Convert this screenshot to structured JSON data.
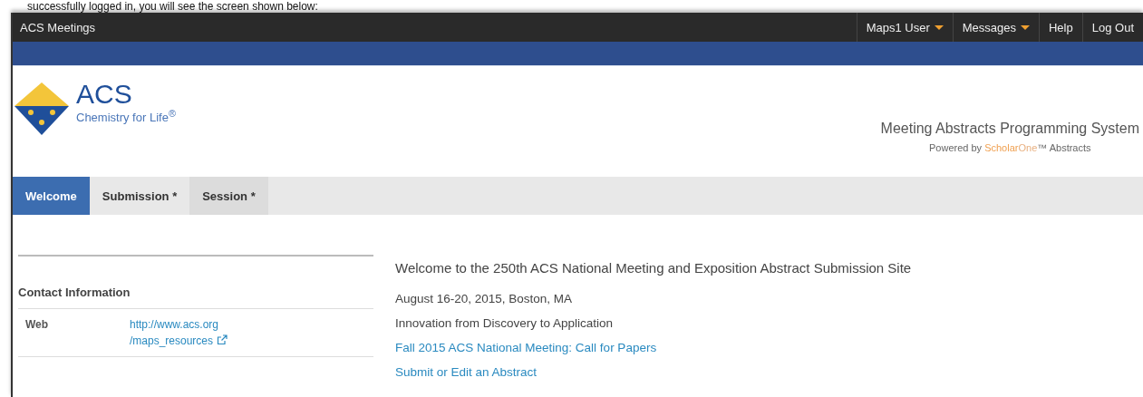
{
  "caption": "successfully logged in, you will see the screen shown below:",
  "top_bar": {
    "title": "ACS Meetings",
    "menu": [
      {
        "label": "Maps1 User",
        "dropdown": true
      },
      {
        "label": "Messages",
        "dropdown": true
      },
      {
        "label": "Help",
        "dropdown": false
      },
      {
        "label": "Log Out",
        "dropdown": false
      }
    ]
  },
  "header": {
    "logo_name": "ACS",
    "logo_tagline": "Chemistry for Life",
    "logo_tagline_mark": "®",
    "system_title": "Meeting Abstracts Programming System",
    "powered": {
      "prefix": "Powered by ",
      "brand_a": "Scholar",
      "brand_b": "One",
      "suffix": "™ Abstracts"
    }
  },
  "tabs": [
    {
      "label": "Welcome",
      "selected": true
    },
    {
      "label": "Submission *",
      "selected": false
    },
    {
      "label": "Session *",
      "selected": false
    }
  ],
  "contact": {
    "heading": "Contact Information",
    "rows": [
      {
        "label": "Web",
        "lines": [
          "http://www.acs.org",
          "/maps_resources"
        ]
      }
    ]
  },
  "main": [
    {
      "kind": "heading",
      "text": "Welcome to the 250th ACS National Meeting and Exposition Abstract Submission Site"
    },
    {
      "kind": "text",
      "text": "August 16-20, 2015, Boston, MA"
    },
    {
      "kind": "text",
      "text": "Innovation from Discovery to Application"
    },
    {
      "kind": "link",
      "text": "Fall 2015 ACS National Meeting: Call for Papers"
    },
    {
      "kind": "link",
      "text": "Submit or Edit an Abstract"
    }
  ]
}
